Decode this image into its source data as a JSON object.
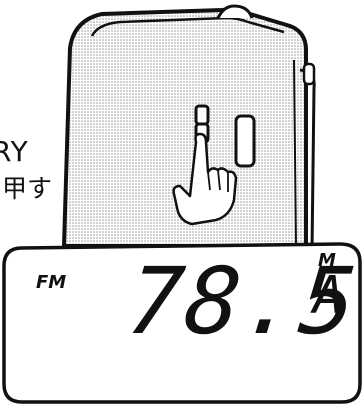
{
  "captions": {
    "memory": "RY",
    "press": "甲す"
  },
  "lcd": {
    "band": "FM",
    "frequency": "78.5",
    "memory_indicator": "M",
    "preset": "A"
  },
  "colors": {
    "line": "#111111",
    "device_shade": "#c8c8c8",
    "background": "#ffffff"
  },
  "icons": {
    "pointer": "pointing-hand-icon"
  }
}
